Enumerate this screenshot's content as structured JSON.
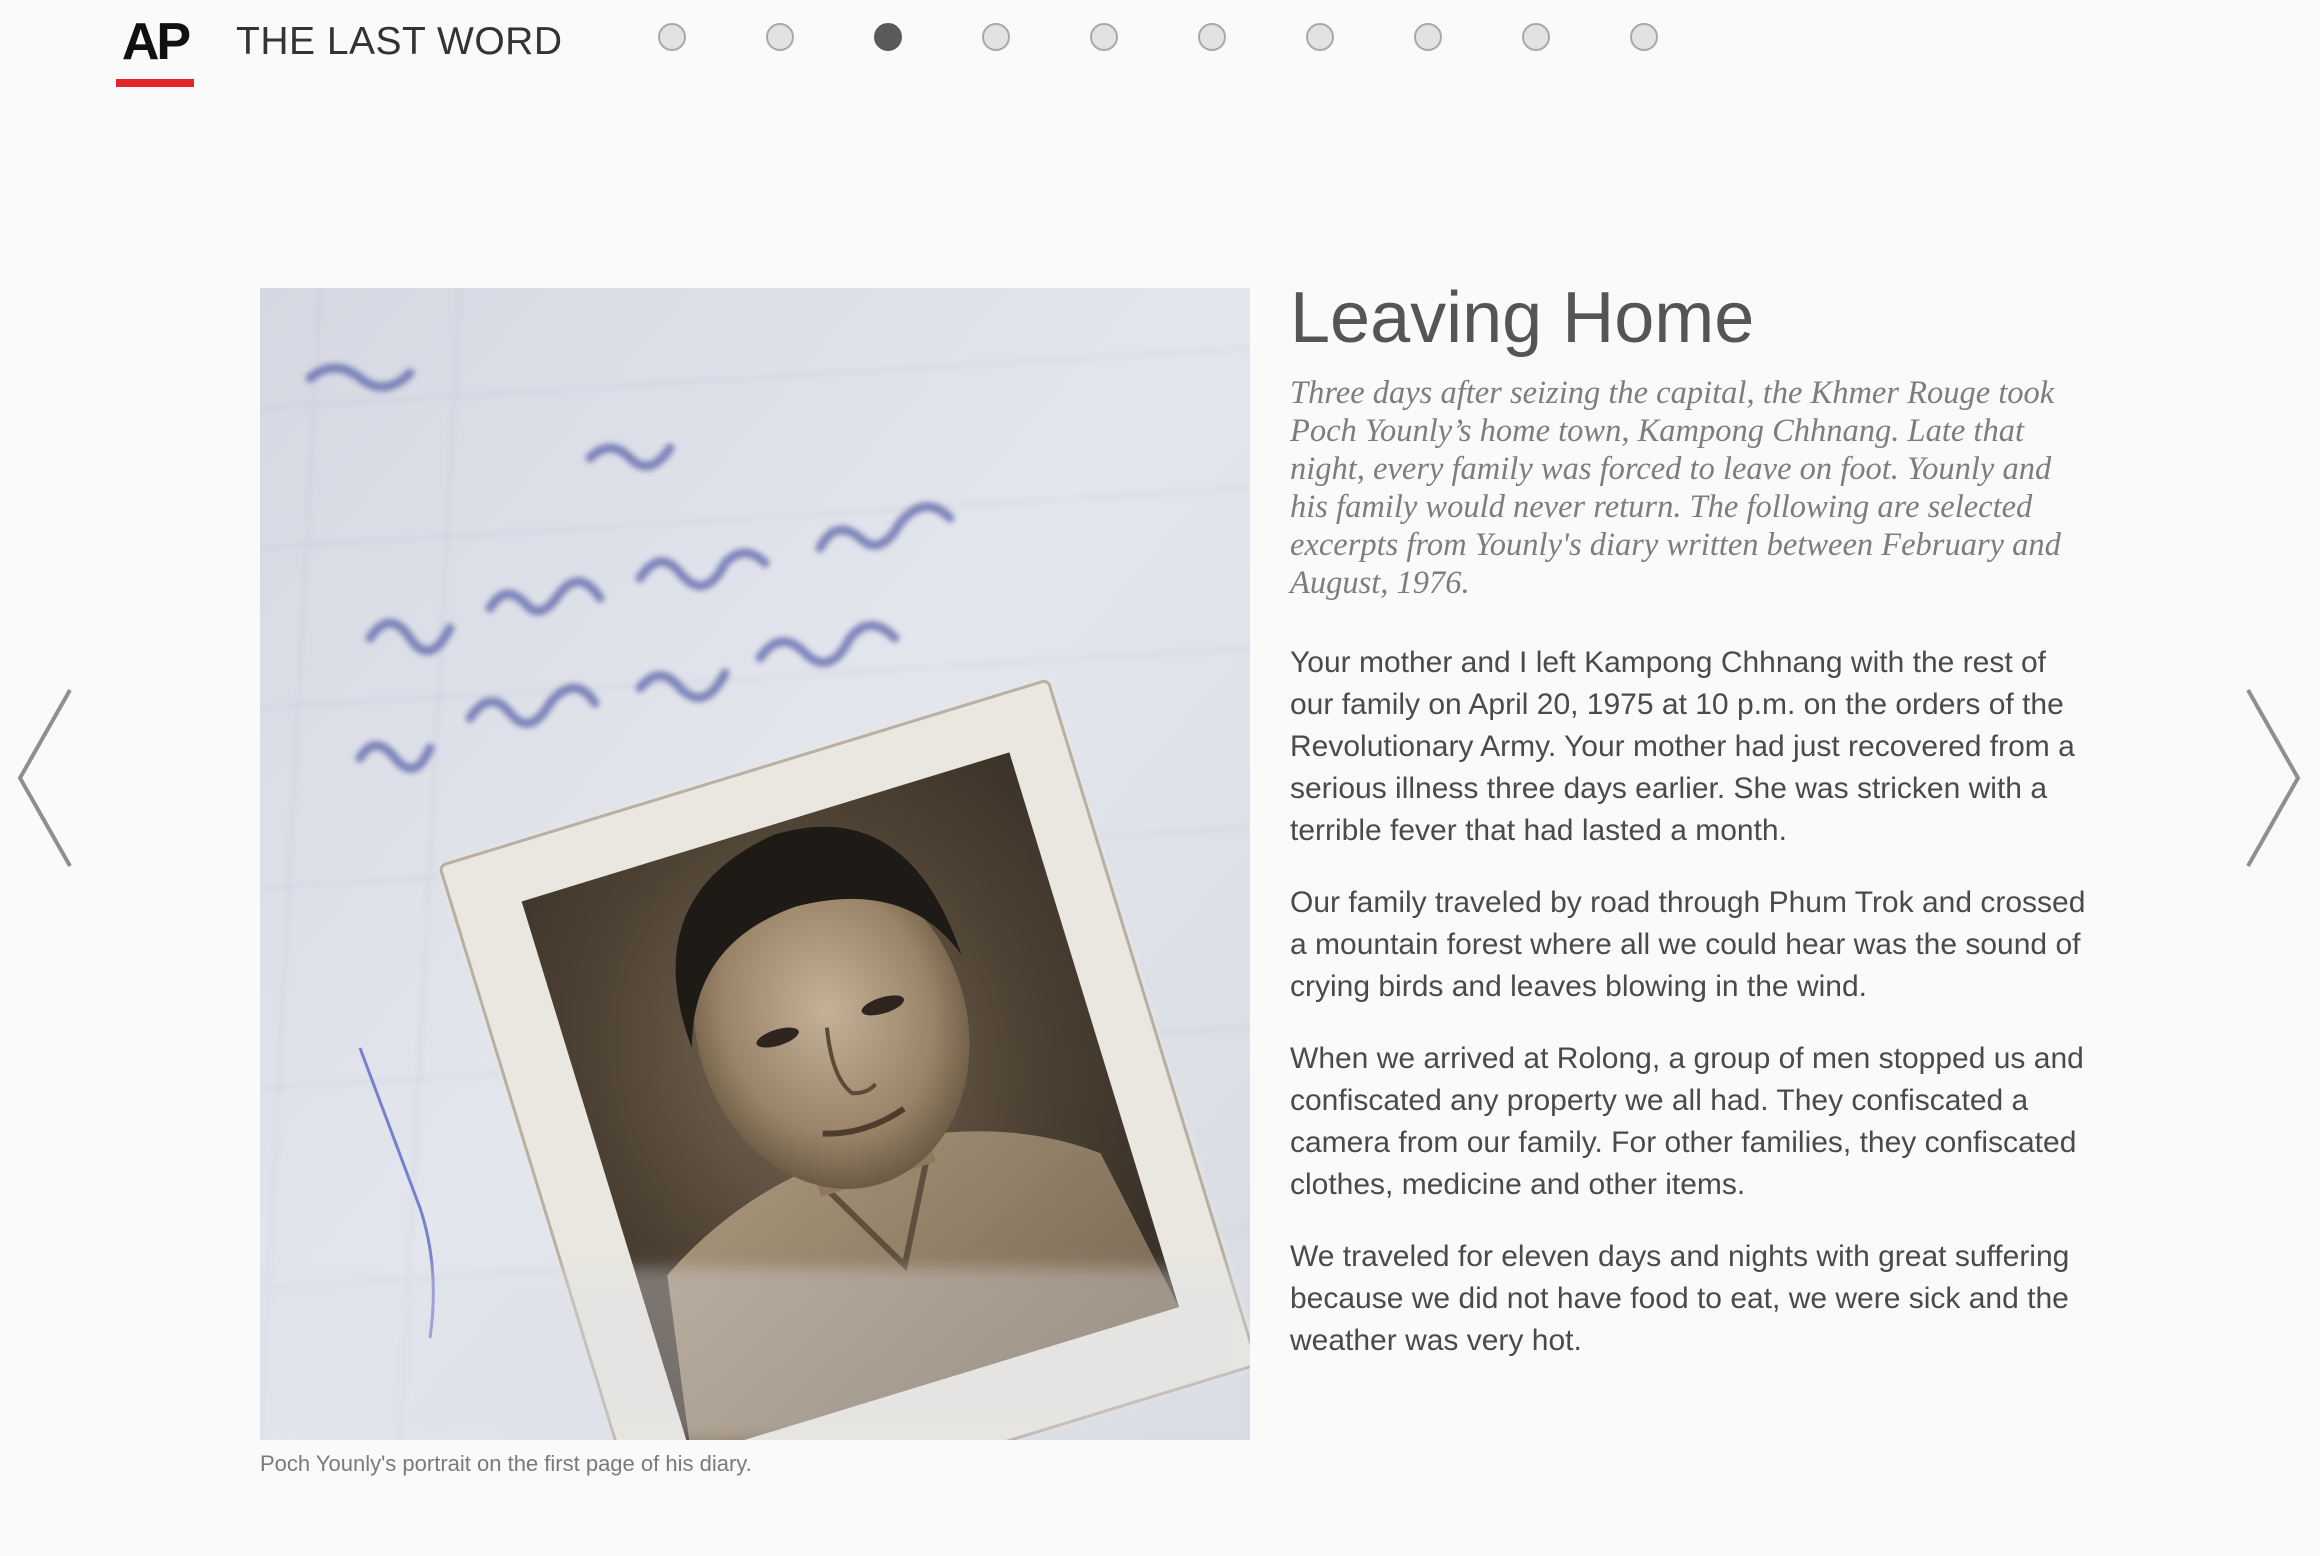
{
  "header": {
    "logo_text": "AP",
    "site_title": "THE LAST WORD",
    "pager": {
      "total": 10,
      "current": 3
    }
  },
  "nav": {
    "prev_icon": "chevron-left-icon",
    "next_icon": "chevron-right-icon"
  },
  "photo": {
    "caption": "Poch Younly's portrait on the first page of his diary."
  },
  "article": {
    "title": "Leaving Home",
    "intro": "Three days after seizing the capital, the Khmer Rouge took Poch Younly’s home town, Kampong Chhnang. Late that night, every family was forced to leave on foot. Younly and his family would never return. The following are selected excerpts from Younly's diary written between February and August, 1976.",
    "paragraphs": [
      "Your mother and I left Kampong Chhnang with the rest of our family on April 20, 1975 at 10 p.m. on the orders of the Revolutionary Army. Your mother had just recovered from a serious illness three days earlier. She was stricken with a terrible fever that had lasted a month.",
      "Our family traveled by road through Phum Trok and crossed a mountain forest where all we could hear was the sound of crying birds and leaves blowing in the wind.",
      "When we arrived at Rolong, a group of men stopped us and confiscated any property we all had. They confiscated a camera from our family. For other families, they confiscated clothes, medicine and other items.",
      "We traveled for eleven days and nights with great suffering because we did not have food to eat, we were sick and the weather was very hot."
    ]
  },
  "colors": {
    "accent_red": "#e3242b",
    "background": "#fafafa",
    "dot_active": "#5a5a5a",
    "dot_inactive": "#e2e2e2"
  }
}
